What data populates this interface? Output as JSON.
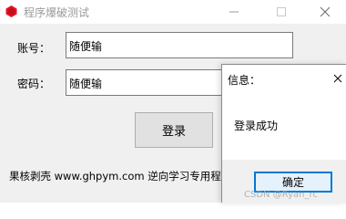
{
  "window": {
    "title": "程序爆破测试",
    "minimize_glyph": "—",
    "maximize_glyph": "☐",
    "close_glyph": "✕",
    "app_icon": "red-hexagon-icon"
  },
  "form": {
    "account_label": "账号：",
    "account_value": "随便输",
    "password_label": "密码：",
    "password_value": "随便输",
    "login_label": "登录"
  },
  "footer": {
    "text": "果核剥壳 www.ghpym.com 逆向学习专用程序"
  },
  "dialog": {
    "title": "信息：",
    "close_glyph": "✕",
    "message": "登录成功",
    "ok_label": "确定",
    "watermark": "CSDN @Ryan_rc"
  },
  "colors": {
    "accent": "#0078d7",
    "window_bg": "#f0f0f0",
    "icon_red": "#e81123"
  }
}
